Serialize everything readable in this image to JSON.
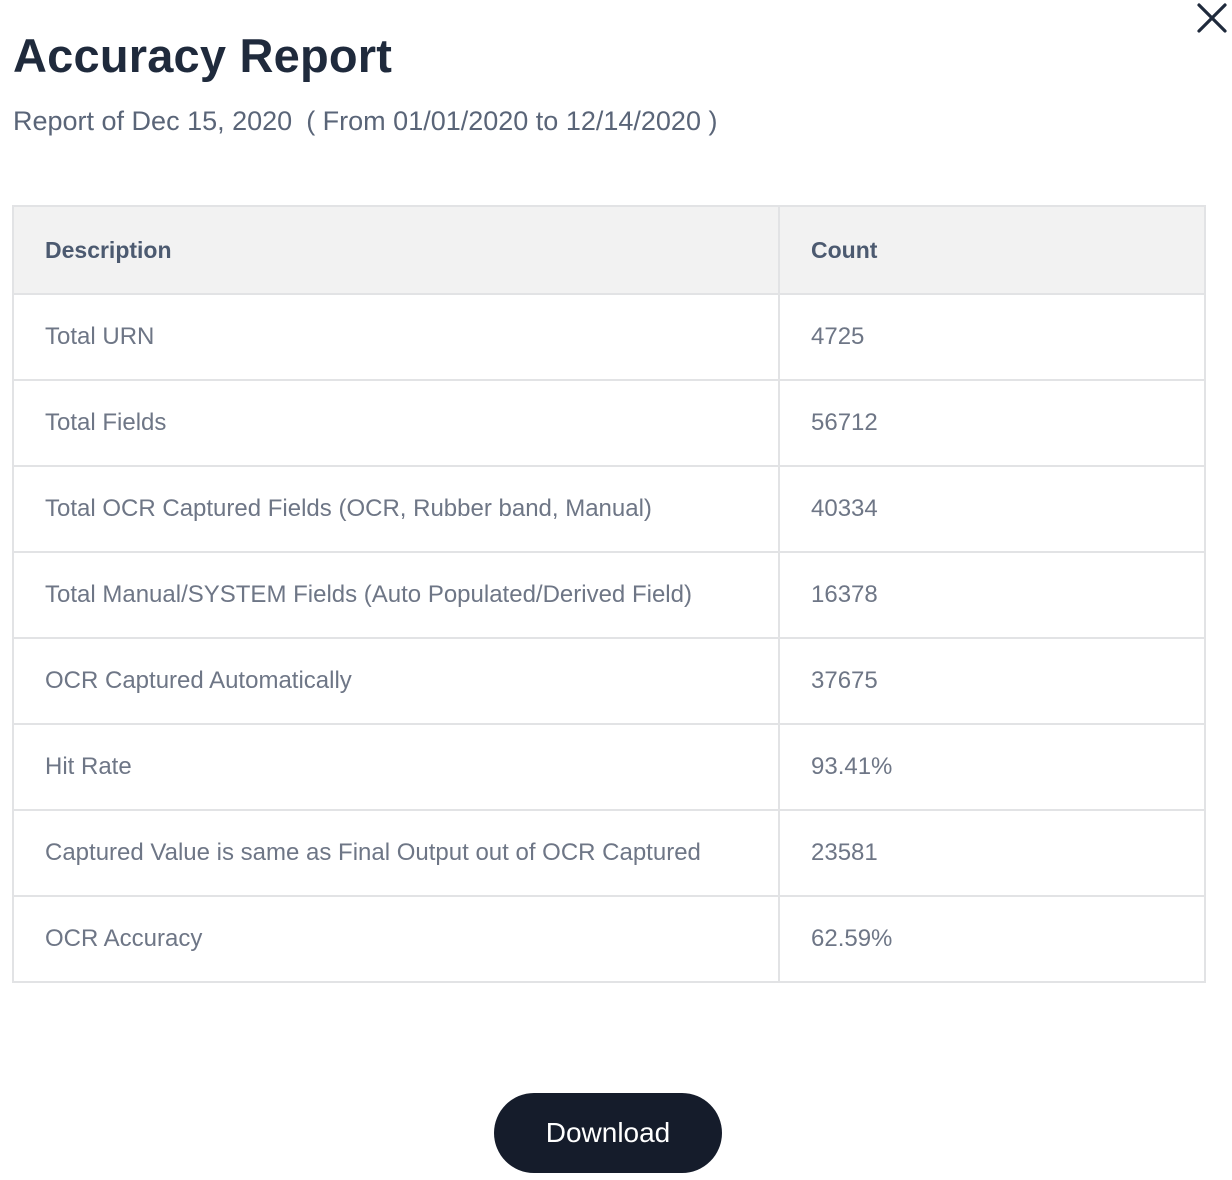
{
  "dialog": {
    "title": "Accuracy Report",
    "subtitle_prefix": "Report of Dec 15, 2020",
    "subtitle_range": "( From 01/01/2020 to 12/14/2020 )",
    "close_icon": "close-icon"
  },
  "table": {
    "headers": [
      "Description",
      "Count"
    ],
    "rows": [
      {
        "description": "Total URN",
        "count": "4725"
      },
      {
        "description": "Total Fields",
        "count": "56712"
      },
      {
        "description": "Total OCR Captured Fields (OCR, Rubber band, Manual)",
        "count": "40334"
      },
      {
        "description": "Total Manual/SYSTEM Fields (Auto Populated/Derived Field)",
        "count": "16378"
      },
      {
        "description": "OCR Captured Automatically",
        "count": "37675"
      },
      {
        "description": "Hit Rate",
        "count": "93.41%"
      },
      {
        "description": "Captured Value is same as Final Output out of OCR Captured",
        "count": "23581"
      },
      {
        "description": "OCR Accuracy",
        "count": "62.59%"
      }
    ]
  },
  "footer": {
    "download_label": "Download"
  },
  "colors": {
    "title": "#1f2a3c",
    "header_bg": "#f2f2f2",
    "border": "#e2e3e5",
    "button_bg": "#151c2b"
  }
}
